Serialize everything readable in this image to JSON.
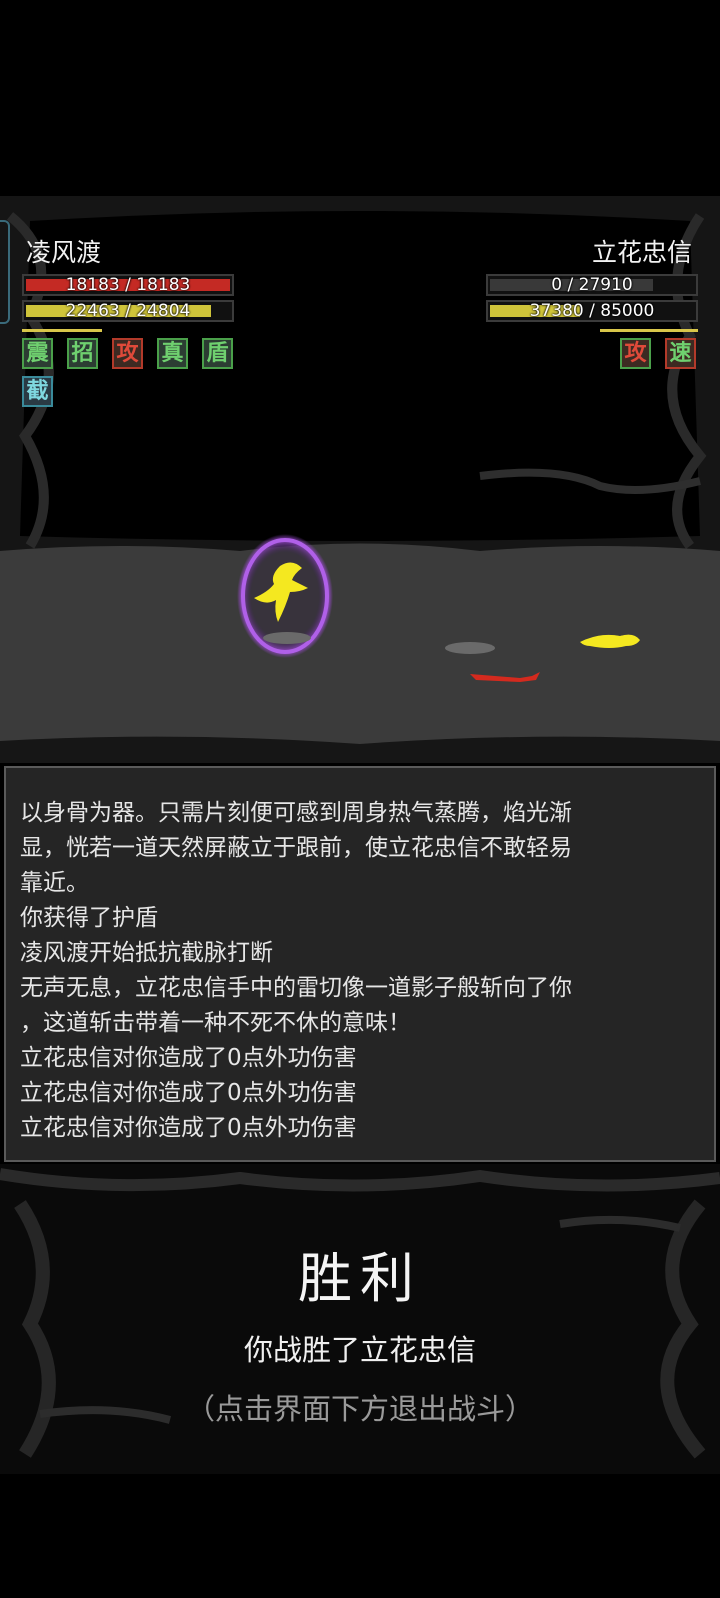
{
  "player": {
    "name": "凌风渡",
    "hp_text": "18183 / 18183",
    "hp_fraction": 1.0,
    "mp_text": "22463 / 24804",
    "mp_fraction": 0.906,
    "buffs": [
      "震",
      "招",
      "攻",
      "真",
      "盾",
      "截"
    ]
  },
  "enemy": {
    "name": "立花忠信",
    "hp_text": "0 / 27910",
    "hp_fraction": 0.0,
    "mp_text": "37380 / 85000",
    "mp_fraction": 0.44,
    "buffs": [
      "攻",
      "速"
    ]
  },
  "colors": {
    "hp_fill": "#c42a24",
    "mp_fill": "#cfc43a",
    "buff_green_text": "#6fd06f",
    "buff_red_text": "#e04a3a",
    "buff_cyan_text": "#7fd8e0",
    "weapon": "#d42a1e",
    "player_figure": "#f4e820",
    "shield_glow": "#9a4ad0"
  },
  "log": [
    "以身骨为器。只需片刻便可感到周身热气蒸腾，焰光渐",
    "显，恍若一道天然屏蔽立于跟前，使立花忠信不敢轻易",
    "靠近。",
    "你获得了护盾",
    "凌风渡开始抵抗截脉打断",
    "无声无息，立花忠信手中的雷切像一道影子般斩向了你",
    "，这道斩击带着一种不死不休的意味！",
    "立花忠信对你造成了0点外功伤害",
    "立花忠信对你造成了0点外功伤害",
    "立花忠信对你造成了0点外功伤害"
  ],
  "result": {
    "title": "胜利",
    "message": "你战胜了立花忠信",
    "hint": "（点击界面下方退出战斗）"
  }
}
